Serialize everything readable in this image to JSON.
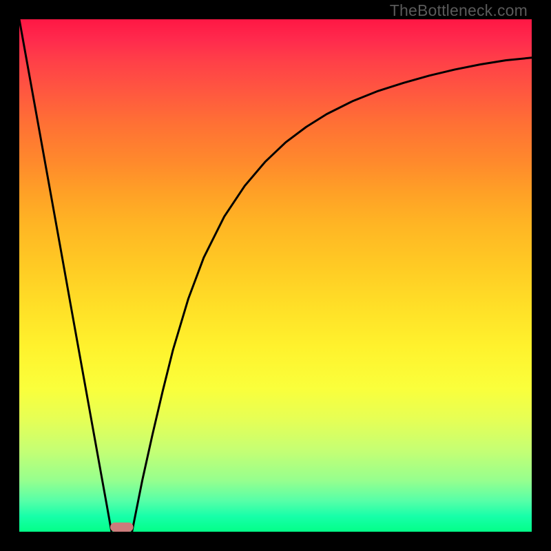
{
  "watermark": "TheBottleneck.com",
  "colors": {
    "frame": "#000000",
    "curve_stroke": "#000000",
    "floor_mark": "#cc7b7b"
  },
  "chart_data": {
    "type": "line",
    "title": "",
    "xlabel": "",
    "ylabel": "",
    "xlim": [
      0,
      100
    ],
    "ylim": [
      0,
      100
    ],
    "grid": false,
    "legend": false,
    "axes": false,
    "series": [
      {
        "name": "left-branch",
        "x": [
          0,
          2,
          4,
          6,
          8,
          10,
          12,
          14,
          16,
          17,
          18
        ],
        "y": [
          100,
          88.9,
          77.8,
          66.7,
          55.6,
          44.4,
          33.3,
          22.2,
          11.1,
          5.6,
          0
        ]
      },
      {
        "name": "right-branch",
        "x": [
          22,
          24,
          26,
          28,
          30,
          33,
          36,
          40,
          44,
          48,
          52,
          56,
          60,
          65,
          70,
          75,
          80,
          85,
          90,
          95,
          100
        ],
        "y": [
          0,
          10,
          19,
          27.5,
          35.5,
          45.5,
          53.5,
          61.5,
          67.5,
          72.2,
          76,
          79,
          81.5,
          84,
          86,
          87.6,
          89,
          90.2,
          91.2,
          92,
          92.5
        ]
      }
    ],
    "annotations": [
      {
        "name": "floor-mark",
        "shape": "rounded-rect",
        "x_center": 20,
        "width": 4.5,
        "y_center": 0.9,
        "height": 1.8
      }
    ]
  }
}
